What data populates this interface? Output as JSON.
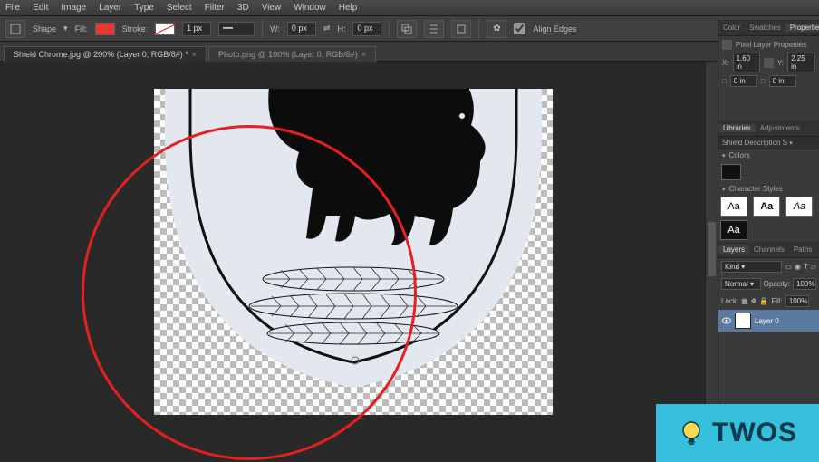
{
  "menu": {
    "items": [
      "File",
      "Edit",
      "Image",
      "Layer",
      "Type",
      "Select",
      "Filter",
      "3D",
      "View",
      "Window",
      "Help"
    ]
  },
  "optionsBar": {
    "tool_label": "Shape",
    "fill_label": "Fill:",
    "stroke_label": "Stroke:",
    "stroke_width": "1 px",
    "w_label": "W:",
    "w_value": "0 px",
    "h_label": "H:",
    "h_value": "0 px",
    "align_label": "Align Edges"
  },
  "tabs": [
    {
      "title": "Shield Chrome.jpg @ 200% (Layer 0, RGB/8#) *",
      "active": true
    },
    {
      "title": "Photo.png @ 100% (Layer 0, RGB/8#)",
      "active": false
    }
  ],
  "panels": {
    "prop_tabs": [
      "Color",
      "Swatches",
      "Properties"
    ],
    "prop_title": "Pixel Layer Properties",
    "prop_row1": {
      "x": "1.60 in",
      "y": "2.25 in"
    },
    "prop_row2": {
      "w": "0 in",
      "h": "0 in"
    },
    "lib_tabs": [
      "Libraries",
      "Adjustments"
    ],
    "lib_name": "Shield Description S",
    "colors_label": "Colors",
    "charstyles_label": "Character Styles",
    "charstyle_samples": [
      "Aa",
      "Aa",
      "Aa",
      "Aa"
    ]
  },
  "layers": {
    "tabs": [
      "Layers",
      "Channels",
      "Paths"
    ],
    "filter": "Kind",
    "blend": "Normal",
    "opacity_label": "Opacity:",
    "opacity": "100%",
    "lock_label": "Lock:",
    "fill_label": "Fill:",
    "fill": "100%",
    "items": [
      {
        "name": "Layer 0"
      }
    ]
  },
  "watermark": {
    "text": "TWOS"
  }
}
